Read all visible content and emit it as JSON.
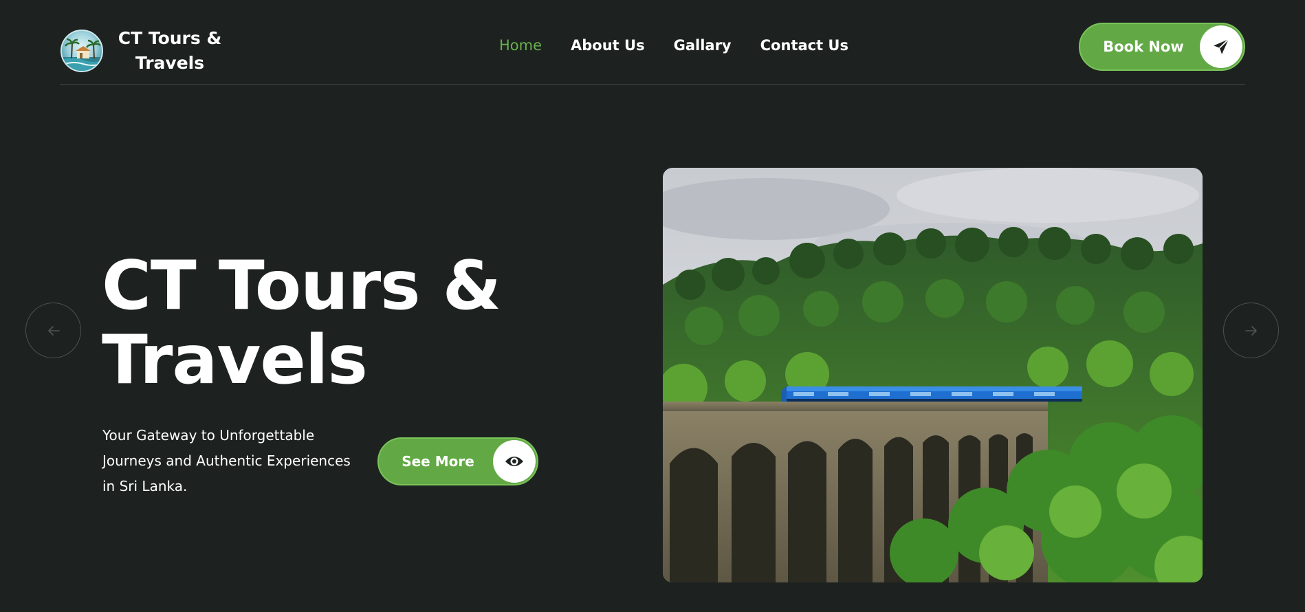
{
  "brand": {
    "name_line1": "CT Tours  &",
    "name_line2": "Travels"
  },
  "nav": {
    "items": [
      {
        "label": "Home",
        "active": true
      },
      {
        "label": "About Us",
        "active": false
      },
      {
        "label": "Gallary",
        "active": false
      },
      {
        "label": "Contact Us",
        "active": false
      }
    ]
  },
  "book_button": {
    "label": "Book Now",
    "icon": "paper-plane-icon"
  },
  "hero": {
    "title_line1": "CT Tours &",
    "title_line2": "Travels",
    "subtitle": "Your Gateway to Unforgettable Journeys and Authentic Experiences in Sri Lanka.",
    "see_more_label": "See More",
    "see_more_icon": "eye-icon",
    "image": "train-on-arched-bridge-in-jungle",
    "prev_icon": "arrow-left-icon",
    "next_icon": "arrow-right-icon"
  },
  "colors": {
    "background": "#1d2220",
    "accent": "#62a945",
    "nav_active": "#6ab04c",
    "text": "#ffffff"
  }
}
